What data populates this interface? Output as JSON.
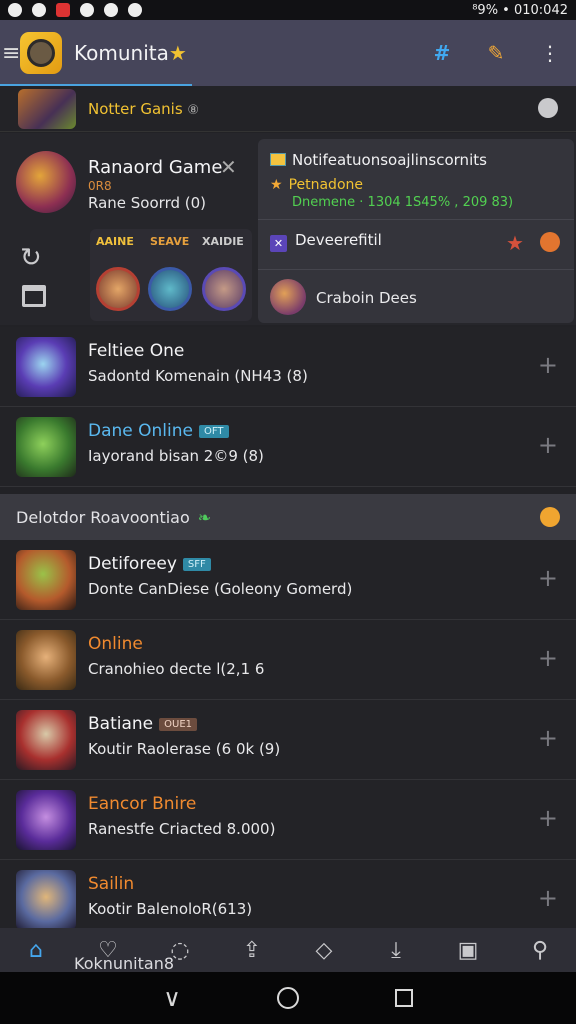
{
  "status_bar": {
    "right_text": "⁸9% • 010:042"
  },
  "app_bar": {
    "title": "Komunita",
    "title_star": "★",
    "icons": [
      "menu-icon",
      "app-logo-icon",
      "hashtag-icon",
      "edit-icon",
      "more-vert-icon"
    ]
  },
  "top_row": {
    "label": "Notter Ganis",
    "suffix": "⑧"
  },
  "middle": {
    "game_title": "Ranaord Game",
    "game_subtitle_1": "0R8",
    "game_subtitle_2": "Rane Soorrd (0)",
    "heroes": [
      "AAINE",
      "SEAVE",
      "XAIDIE"
    ],
    "notification": {
      "title": "Notifeatuonsoajlinscornits",
      "yellow_text": "Petnadone",
      "green_text": "Dnemene · 1304 1S45% , 209 83)",
      "row2_label": "Deveerefitil",
      "row3_label": "Craboin Dees"
    }
  },
  "list_top": [
    {
      "title": "Feltiee One",
      "subtitle": "Sadontd Komenain (NH43 (8)",
      "title_color": "#f4f4f6",
      "badge": ""
    },
    {
      "title": "Dane Online",
      "subtitle": "Iayorand bisan 2©9 (8)",
      "title_color": "#5ab8ef",
      "badge": "OFT"
    }
  ],
  "section_header": {
    "title": "Delotdor Roavoontiao"
  },
  "list_bottom": [
    {
      "title": "Detiforeey",
      "subtitle": "Donte CanDiese (Goleony Gomerd)",
      "title_color": "#f4f4f6",
      "badge": "SFF"
    },
    {
      "title": "Online",
      "subtitle": "Cranohieo decte l(2,1 6",
      "title_color": "#f08a2f",
      "badge": ""
    },
    {
      "title": "Batiane",
      "subtitle": "Koutir Raolerase (6 0k (9)",
      "title_color": "#f4f4f6",
      "badge": "OUE1"
    },
    {
      "title": "Eancor Bnire",
      "subtitle": "Ranestfe Criacted 8.000)",
      "title_color": "#f08a2f",
      "badge": ""
    },
    {
      "title": "Sailin",
      "subtitle": "Kootir BalenoloR(613)",
      "title_color": "#f08a2f",
      "badge": ""
    }
  ],
  "bottom_nav": {
    "label": "Koknunitan8"
  }
}
